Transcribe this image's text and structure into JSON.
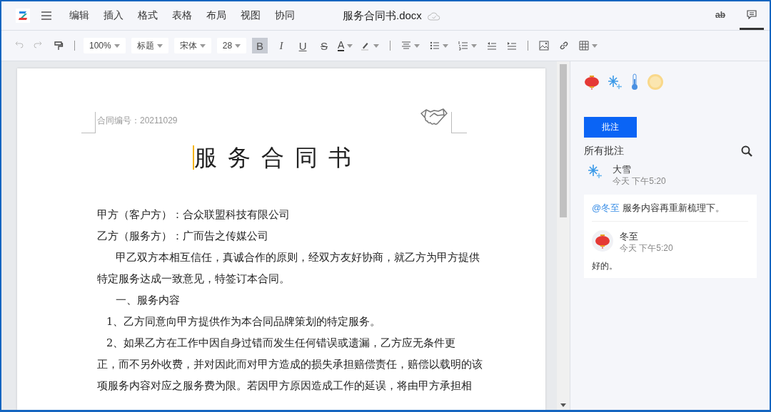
{
  "app": {
    "menu": [
      "编辑",
      "插入",
      "格式",
      "表格",
      "布局",
      "视图",
      "协同"
    ],
    "file_title": "服务合同书.docx",
    "view_tabs": [
      {
        "label": "ab",
        "selected": false
      },
      {
        "selected": true
      }
    ]
  },
  "toolbar": {
    "zoom": "100%",
    "style": "标题",
    "font": "宋体",
    "size": "28",
    "format_buttons": [
      {
        "label": "B",
        "active": true
      },
      {
        "label": "I",
        "active": false
      },
      {
        "label": "U",
        "active": false
      },
      {
        "label": "S",
        "active": false
      }
    ],
    "font_color": {
      "label": "A"
    }
  },
  "document": {
    "contract_no": "合同编号：20211029",
    "title": "服务合同书",
    "lines": [
      {
        "kind": "flush",
        "text": "甲方（客户方）：合众联盟科技有限公司"
      },
      {
        "kind": "flush",
        "text": "乙方（服务方）：广而告之传媒公司"
      },
      {
        "kind": "indent",
        "text": "甲乙双方本相互信任，真诚合作的原则，经双方友好协商，就乙方为甲方提供"
      },
      {
        "kind": "flush",
        "text": "特定服务达成一致意见，特签订本合同。"
      },
      {
        "kind": "indent",
        "text": "一、服务内容"
      },
      {
        "kind": "numbered",
        "text": "1、乙方同意向甲方提供作为本合同品牌策划的特定服务。"
      },
      {
        "kind": "numbered",
        "text": "2、如果乙方在工作中因自身过错而发生任何错误或遗漏，乙方应无条件更"
      },
      {
        "kind": "flush",
        "text": "正，而不另外收费，并对因此而对甲方造成的损失承担赔偿责任，赔偿以载明的该"
      },
      {
        "kind": "flush",
        "text": "项服务内容对应之服务费为限。若因甲方原因造成工作的延误，将由甲方承担相"
      }
    ]
  },
  "comments": {
    "button": "批注",
    "heading": "所有批注",
    "thread": {
      "author": "大雪",
      "time": "今天 下午5:20",
      "mention": "@冬至",
      "text": "服务内容再重新梳理下。",
      "reply": {
        "author": "冬至",
        "time": "今天 下午5:20",
        "text": "好的。"
      }
    }
  }
}
